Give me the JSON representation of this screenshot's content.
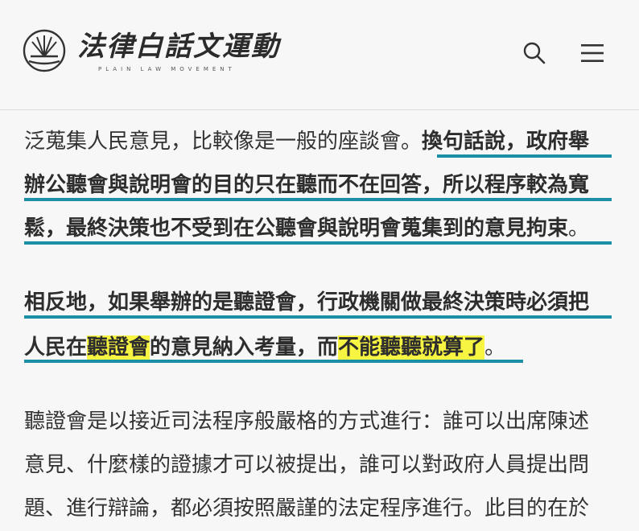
{
  "header": {
    "logo_cn": "法律白話文運動",
    "logo_en": "PLAIN LAW MOVEMENT",
    "search_icon": "search-icon",
    "menu_icon": "hamburger-menu-icon"
  },
  "article": {
    "p1": {
      "l1_plain": "泛蒐集人民意見，比較像是一般的座談會。",
      "l1_bold": "換句話說，政府舉",
      "l2_bold": "辦公聽會與說明會的目的只在聽而不在回答，所以程序較為寬",
      "l3_bold": "鬆，最終決策也不受到在公聽會與說明會蒐集到的意見拘束",
      "l3_end": "。"
    },
    "p2": {
      "l1_bold": "相反地，如果舉辦的是聽證會，行政機關做最終決策時必須把",
      "l2_a": "人民在",
      "l2_hl1": "聽證會",
      "l2_b": "的意見納入考量，而",
      "l2_hl2": "不能聽聽就算了",
      "l2_end": "。"
    },
    "p3": {
      "l1": "聽證會是以接近司法程序般嚴格的方式進行：誰可以出席陳述",
      "l2": "意見、什麼樣的證據才可以被提出，誰可以對政府人員提出問",
      "l3": "題、進行辯論，都必須按照嚴謹的法定程序進行。此目的在於"
    },
    "colors": {
      "underline": "#1a8fa6",
      "highlight": "#f8f542"
    }
  }
}
